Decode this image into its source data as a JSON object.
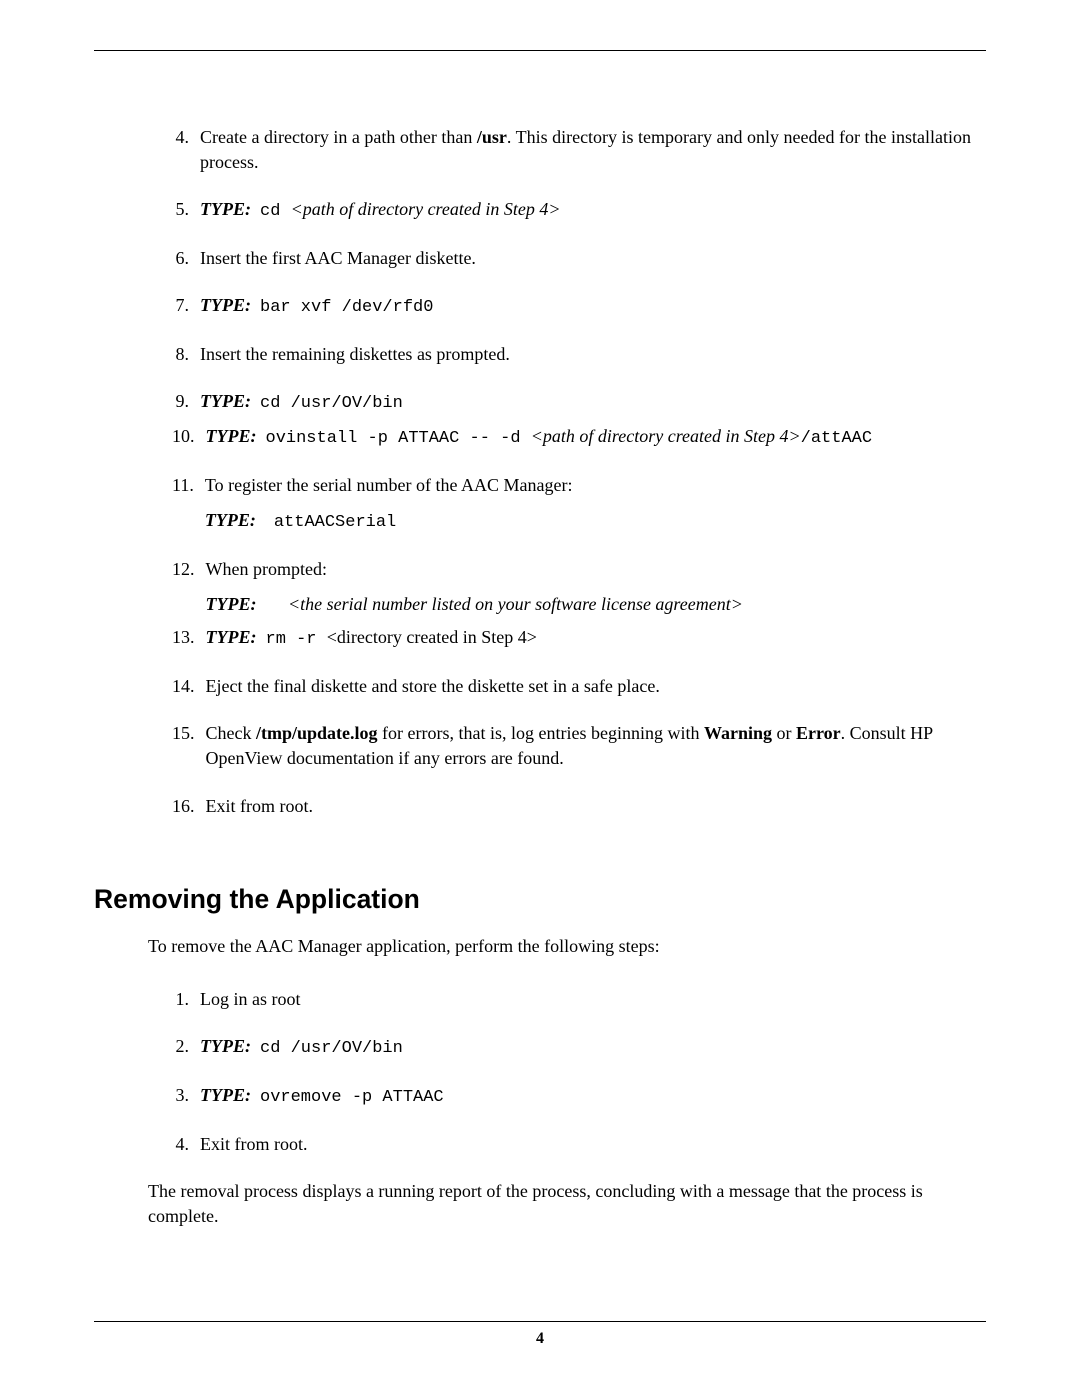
{
  "steps": [
    {
      "num": "4.",
      "text_a": "Create a directory in a path other than ",
      "usr": "/usr",
      "text_b": ". This directory is temporary and only needed for the installation process."
    },
    {
      "num": "5.",
      "type": "TYPE:",
      "cmd": "cd  ",
      "arg": "<path of directory created in Step 4>"
    },
    {
      "num": "6.",
      "text": "Insert the first AAC Manager diskette."
    },
    {
      "num": "7.",
      "type": "TYPE:",
      "cmd": "bar xvf /dev/rfd0"
    },
    {
      "num": "8.",
      "text": "Insert the remaining diskettes as prompted."
    },
    {
      "num": "9.",
      "type": "TYPE:",
      "cmd": "cd /usr/OV/bin"
    },
    {
      "num": "10.",
      "type": "TYPE:",
      "cmd1": "ovinstall -p ATTAAC -- -d ",
      "arg": "<path of directory created in Step 4>",
      "cmd2": "/attAAC"
    },
    {
      "num": "11.",
      "text": "To register the serial number of the AAC Manager:",
      "sub_type": "TYPE:",
      "sub_cmd": "attAACSerial"
    },
    {
      "num": "12.",
      "text": "When prompted:",
      "sub_type": "TYPE:",
      "sub_arg": "<the serial number listed on your software license agreement>"
    },
    {
      "num": "13.",
      "type": "TYPE:",
      "cmd": "rm -r  ",
      "plain": "<directory created in Step 4>"
    },
    {
      "num": "14.",
      "text": "Eject the final diskette and store the diskette set in a safe place."
    },
    {
      "num": "15.",
      "text_a": "Check ",
      "b1": "/tmp/update.log",
      "text_b": " for errors, that is, log entries beginning with ",
      "b2": "Warning",
      "text_c": " or ",
      "b3": "Error",
      "text_d": ". Consult HP OpenView documentation if any errors are found."
    },
    {
      "num": "16.",
      "text": "Exit from root."
    }
  ],
  "removing": {
    "heading": "Removing the Application",
    "intro": "To remove the AAC Manager application, perform the following steps:",
    "steps": [
      {
        "num": "1.",
        "text": "Log in as root"
      },
      {
        "num": "2.",
        "type": "TYPE:",
        "cmd": "cd /usr/OV/bin"
      },
      {
        "num": "3.",
        "type": "TYPE:",
        "cmd": "ovremove -p ATTAAC"
      },
      {
        "num": "4.",
        "text": "Exit from root."
      }
    ],
    "closing": "The removal process displays a running report of the process, concluding with a message that the process is complete."
  },
  "page_number": "4"
}
